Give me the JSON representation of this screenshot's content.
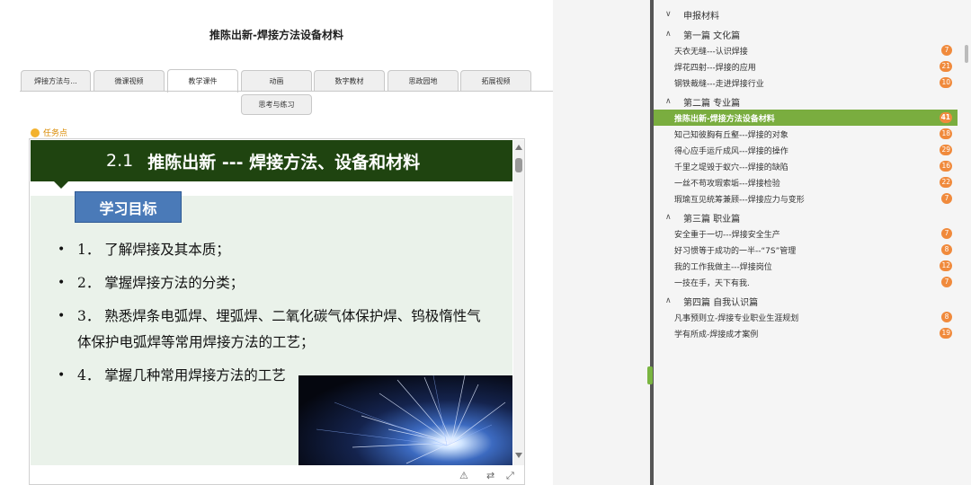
{
  "page": {
    "title": "推陈出新-焊接方法设备材料"
  },
  "tabs": [
    {
      "label": "焊接方法与..."
    },
    {
      "label": "微课视频"
    },
    {
      "label": "教学课件",
      "active": true
    },
    {
      "label": "动画"
    },
    {
      "label": "数字教材"
    },
    {
      "label": "思政园地"
    },
    {
      "label": "拓展视频"
    },
    {
      "label": "思考与练习"
    }
  ],
  "task_label": "任务点",
  "slide": {
    "number": "2.1",
    "title": "推陈出新 --- 焊接方法、设备和材料",
    "goal_heading": "学习目标",
    "goals": [
      "1． 了解焊接及其本质；",
      "2． 掌握焊接方法的分类；",
      "3． 熟悉焊条电弧焊、埋弧焊、二氧化碳气体保护焊、钨极惰性气体保护电弧焊等常用焊接方法的工艺；",
      "4． 掌握几种常用焊接方法的工艺"
    ]
  },
  "toolbar": {
    "warn_icon": "warning-icon",
    "swap_icon": "swap-icon",
    "fullscreen_icon": "fullscreen-icon"
  },
  "outline": {
    "root": "申报材料",
    "sections": [
      {
        "title": "第一篇 文化篇",
        "items": [
          {
            "label": "天衣无缝---认识焊接",
            "count": "7"
          },
          {
            "label": "焊花四射---焊接的应用",
            "count": "21"
          },
          {
            "label": "钢铁裁缝---走进焊接行业",
            "count": "10"
          }
        ]
      },
      {
        "title": "第二篇 专业篇",
        "items": [
          {
            "label": "推陈出新-焊接方法设备材料",
            "count": "41",
            "active": true
          },
          {
            "label": "知己知彼胸有丘壑---焊接的对象",
            "count": "18"
          },
          {
            "label": "得心应手运斤成风---焊接的操作",
            "count": "29"
          },
          {
            "label": "千里之堤毁于蚁穴---焊接的缺陷",
            "count": "16"
          },
          {
            "label": "一丝不苟攻瑕索垢---焊接检验",
            "count": "22"
          },
          {
            "label": "瑕瑜互见统筹兼顾---焊接应力与变形",
            "count": "7"
          }
        ]
      },
      {
        "title": "第三篇 职业篇",
        "items": [
          {
            "label": "安全重于一切---焊接安全生产",
            "count": "7"
          },
          {
            "label": "好习惯等于成功的一半--“7S”管理",
            "count": "8"
          },
          {
            "label": "我的工作我做主---焊接岗位",
            "count": "12"
          },
          {
            "label": "一技在手，天下有我.",
            "count": "7"
          }
        ]
      },
      {
        "title": "第四篇 自我认识篇",
        "items": [
          {
            "label": "凡事预则立-焊接专业职业生涯规划",
            "count": "8"
          },
          {
            "label": "学有所成-焊接成才案例",
            "count": "19"
          }
        ]
      }
    ]
  }
}
